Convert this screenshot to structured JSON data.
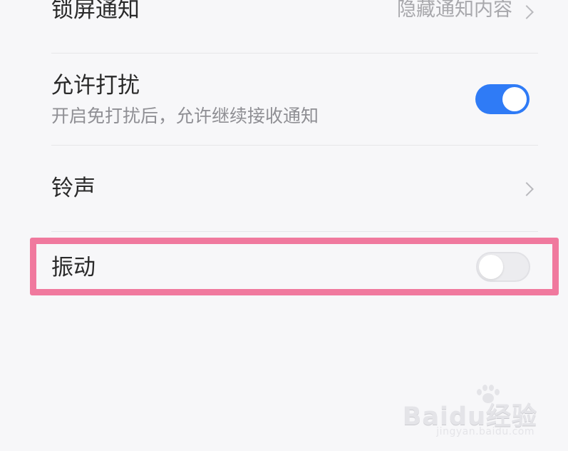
{
  "settings": {
    "items": [
      {
        "title": "锁屏通知",
        "value": "隐藏通知内容"
      },
      {
        "title": "允许打扰",
        "subtitle": "开启免打扰后，允许继续接收通知",
        "switch_state": "on"
      },
      {
        "title": "铃声"
      },
      {
        "title": "振动",
        "switch_state": "off"
      }
    ]
  },
  "watermark": {
    "logo": "Baidu经验",
    "url": "jingyan.baidu.com"
  },
  "colors": {
    "switch_on": "#2f7bf6",
    "highlight_border": "#f0799e"
  }
}
